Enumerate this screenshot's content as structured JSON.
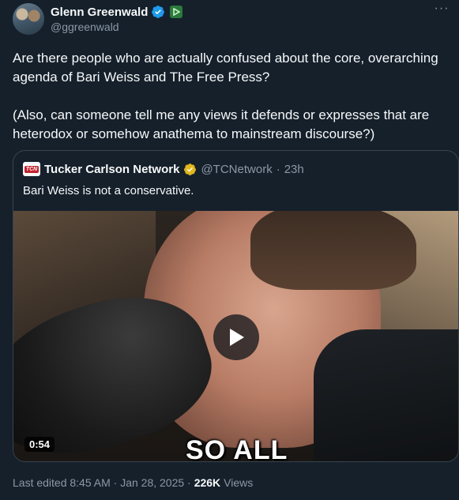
{
  "author": {
    "display_name": "Glenn Greenwald",
    "handle": "@ggreenwald",
    "verified_icon": "verified-badge-icon",
    "extra_icon": "rumble-icon"
  },
  "more_icon": "more-options-icon",
  "tweet": {
    "text": "Are there people who are actually confused about the core, overarching agenda of Bari Weiss and The Free Press?\n\n(Also, can someone tell me any views it defends or expresses that are heterodox or somehow anathema to mainstream discourse?)"
  },
  "quote": {
    "logo_text": "TCN",
    "display_name": "Tucker Carlson Network",
    "handle": "@TCNetwork",
    "separator": "·",
    "time": "23h",
    "text": "Bari Weiss is not a conservative.",
    "video": {
      "duration": "0:54",
      "caption": "SO ALL"
    }
  },
  "meta": {
    "edited": "Last edited 8:45 AM · Jan 28, 2025 ·",
    "views_count": "226K",
    "views_label": "Views"
  },
  "colors": {
    "background": "#15202b",
    "text": "#f7f9f9",
    "secondary": "#8b98a5",
    "verified_blue": "#1d9bf0",
    "gold": "#e2b719",
    "border": "#38444d"
  }
}
